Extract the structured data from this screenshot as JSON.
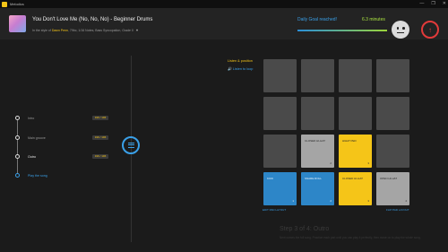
{
  "app": {
    "name": "Melodics"
  },
  "window_controls": [
    "—",
    "❐",
    "✕"
  ],
  "song": {
    "title": "You Don't Love Me (No, No, No) - Beginner Drums",
    "meta_prefix": "In the style of",
    "artist": "Dawn Penn",
    "meta_suffix": ", 79bc, 1/16 Notes, Bass Syncopation, Grade 0"
  },
  "goal": {
    "label": "Daily Goal reached!",
    "minutes": "6.3 minutes",
    "progress": 1.0
  },
  "steps": [
    {
      "label": "Intro",
      "badge": "196 / 196",
      "state": "done"
    },
    {
      "label": "Main groove",
      "badge": "196 / 196",
      "state": "done"
    },
    {
      "label": "Outro",
      "badge": "196 / 196",
      "state": "active"
    },
    {
      "label": "Play the song",
      "state": "song"
    }
  ],
  "listen": {
    "title": "Listen & position",
    "item": "Listen to loop"
  },
  "pads": [
    {
      "style": "gray",
      "label": "",
      "num": ""
    },
    {
      "style": "gray",
      "label": "",
      "num": ""
    },
    {
      "style": "gray",
      "label": "",
      "num": ""
    },
    {
      "style": "gray",
      "label": "",
      "num": ""
    },
    {
      "style": "gray",
      "label": "",
      "num": ""
    },
    {
      "style": "gray",
      "label": "",
      "num": ""
    },
    {
      "style": "gray",
      "label": "",
      "num": ""
    },
    {
      "style": "gray",
      "label": "",
      "num": ""
    },
    {
      "style": "gray",
      "label": "",
      "num": ""
    },
    {
      "style": "light",
      "label": "CLOSED HI-HAT",
      "num": "2"
    },
    {
      "style": "yellow",
      "label": "HIHAT PED",
      "num": "3"
    },
    {
      "style": "gray",
      "label": "",
      "num": ""
    },
    {
      "style": "blue",
      "label": "KICK",
      "num": "1"
    },
    {
      "style": "blue",
      "label": "SNARE ROLL",
      "num": "2"
    },
    {
      "style": "yellow",
      "label": "CLOSED HI-HAT",
      "num": "3"
    },
    {
      "style": "light",
      "label": "OPEN HI-HAT",
      "num": "4"
    }
  ],
  "layout": {
    "left": "EDIT PAD LAYOUT",
    "right": "FLIP PAD LAYOUT"
  },
  "faint": {
    "title": "Step 3 of 4: Outro",
    "subtitle": "Next comes the full song. Practice each part until you can play it perfectly, then move on to play the whole song."
  }
}
